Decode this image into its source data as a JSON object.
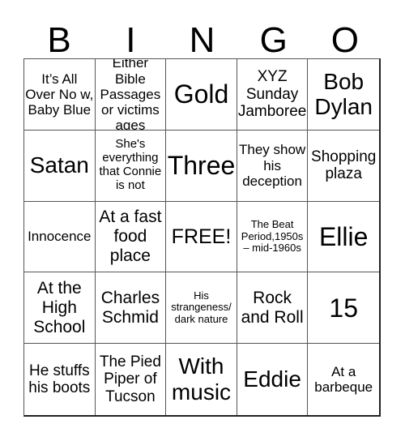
{
  "header": [
    "B",
    "I",
    "N",
    "G",
    "O"
  ],
  "cells": [
    "It’s All Over No w, Baby Blue",
    "Either Bible Passages or victims ages",
    "Gold",
    "XYZ Sunday Jamboree",
    "Bob Dylan",
    "Satan",
    "She's everything that Connie is not",
    "Three",
    "They show his deception",
    "Shopping plaza",
    "Innocence",
    "At a fast food place",
    "FREE!",
    "The Beat Period,1950s – mid-1960s",
    "Ellie",
    "At the High School",
    "Charles Schmid",
    "His strangeness/ dark nature",
    "Rock and Roll",
    "15",
    "He stuffs his boots",
    "The Pied Piper of Tucson",
    "With music",
    "Eddie",
    "At a barbeque"
  ]
}
